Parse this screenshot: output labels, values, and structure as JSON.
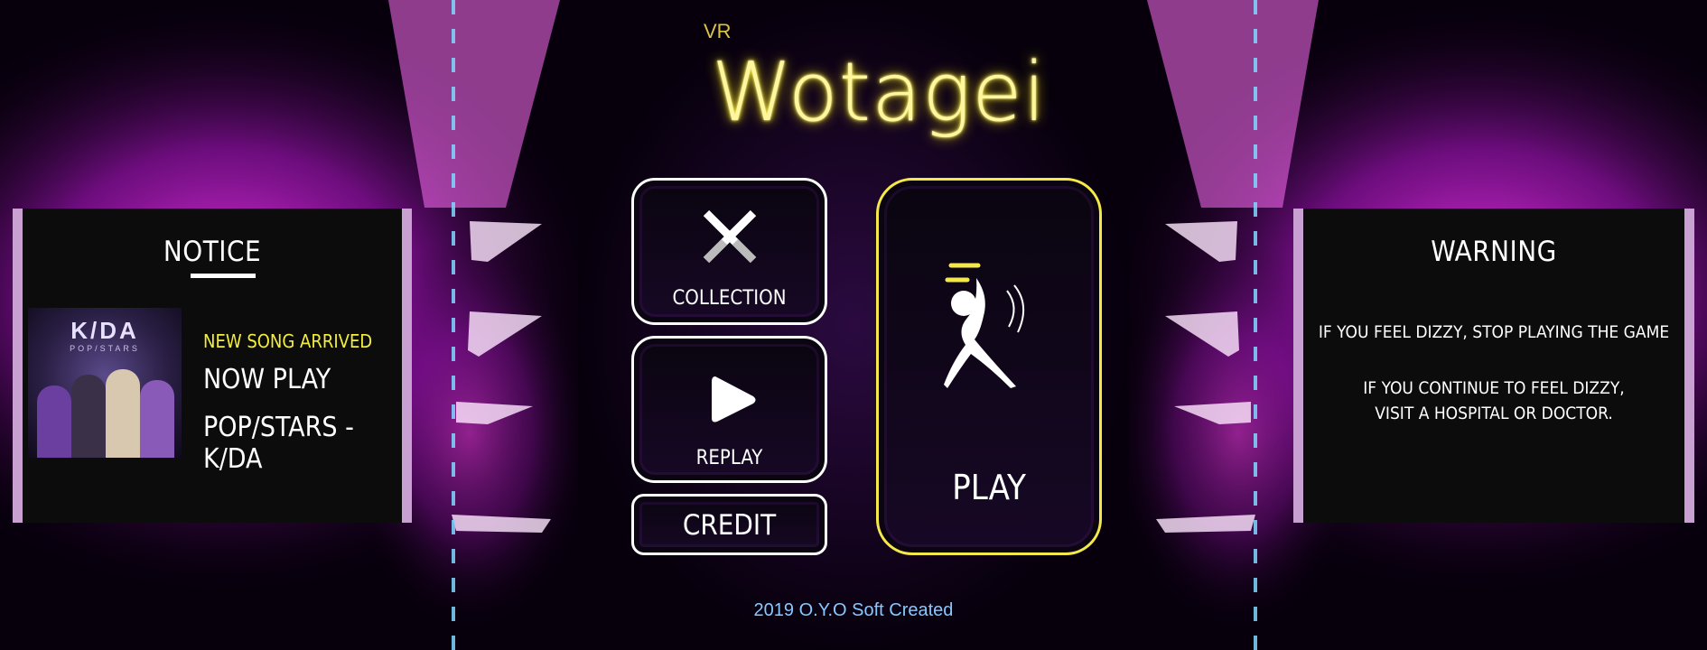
{
  "header": {
    "vr_label": "VR",
    "title": "Wotagei"
  },
  "notice_panel": {
    "title": "NOTICE",
    "album_art": {
      "logo": "K/DA",
      "subtitle": "POP/STARS"
    },
    "new_song_label": "NEW SONG ARRIVED",
    "now_play_label": "NOW PLAY",
    "song_title": "POP/STARS - K/DA"
  },
  "menu": {
    "collection_label": "COLLECTION",
    "replay_label": "REPLAY",
    "credit_label": "CREDIT",
    "play_label": "PLAY"
  },
  "warning_panel": {
    "title": "WARNING",
    "line1": "IF YOU FEEL DIZZY, STOP PLAYING THE GAME",
    "line2": "IF YOU CONTINUE TO FEEL DIZZY,",
    "line3": "VISIT A HOSPITAL OR DOCTOR."
  },
  "footer": {
    "text": "2019 O.Y.O Soft Created"
  },
  "colors": {
    "accent_yellow": "#f5e94a",
    "notice_yellow": "#f3ee3b",
    "footer_blue": "#88c8ff",
    "panel_border": "#c9a0d2",
    "dash_blue": "#7fd8ff"
  },
  "icons": [
    "crossed-sticks-icon",
    "play-triangle-icon",
    "wotagei-dancer-icon"
  ]
}
